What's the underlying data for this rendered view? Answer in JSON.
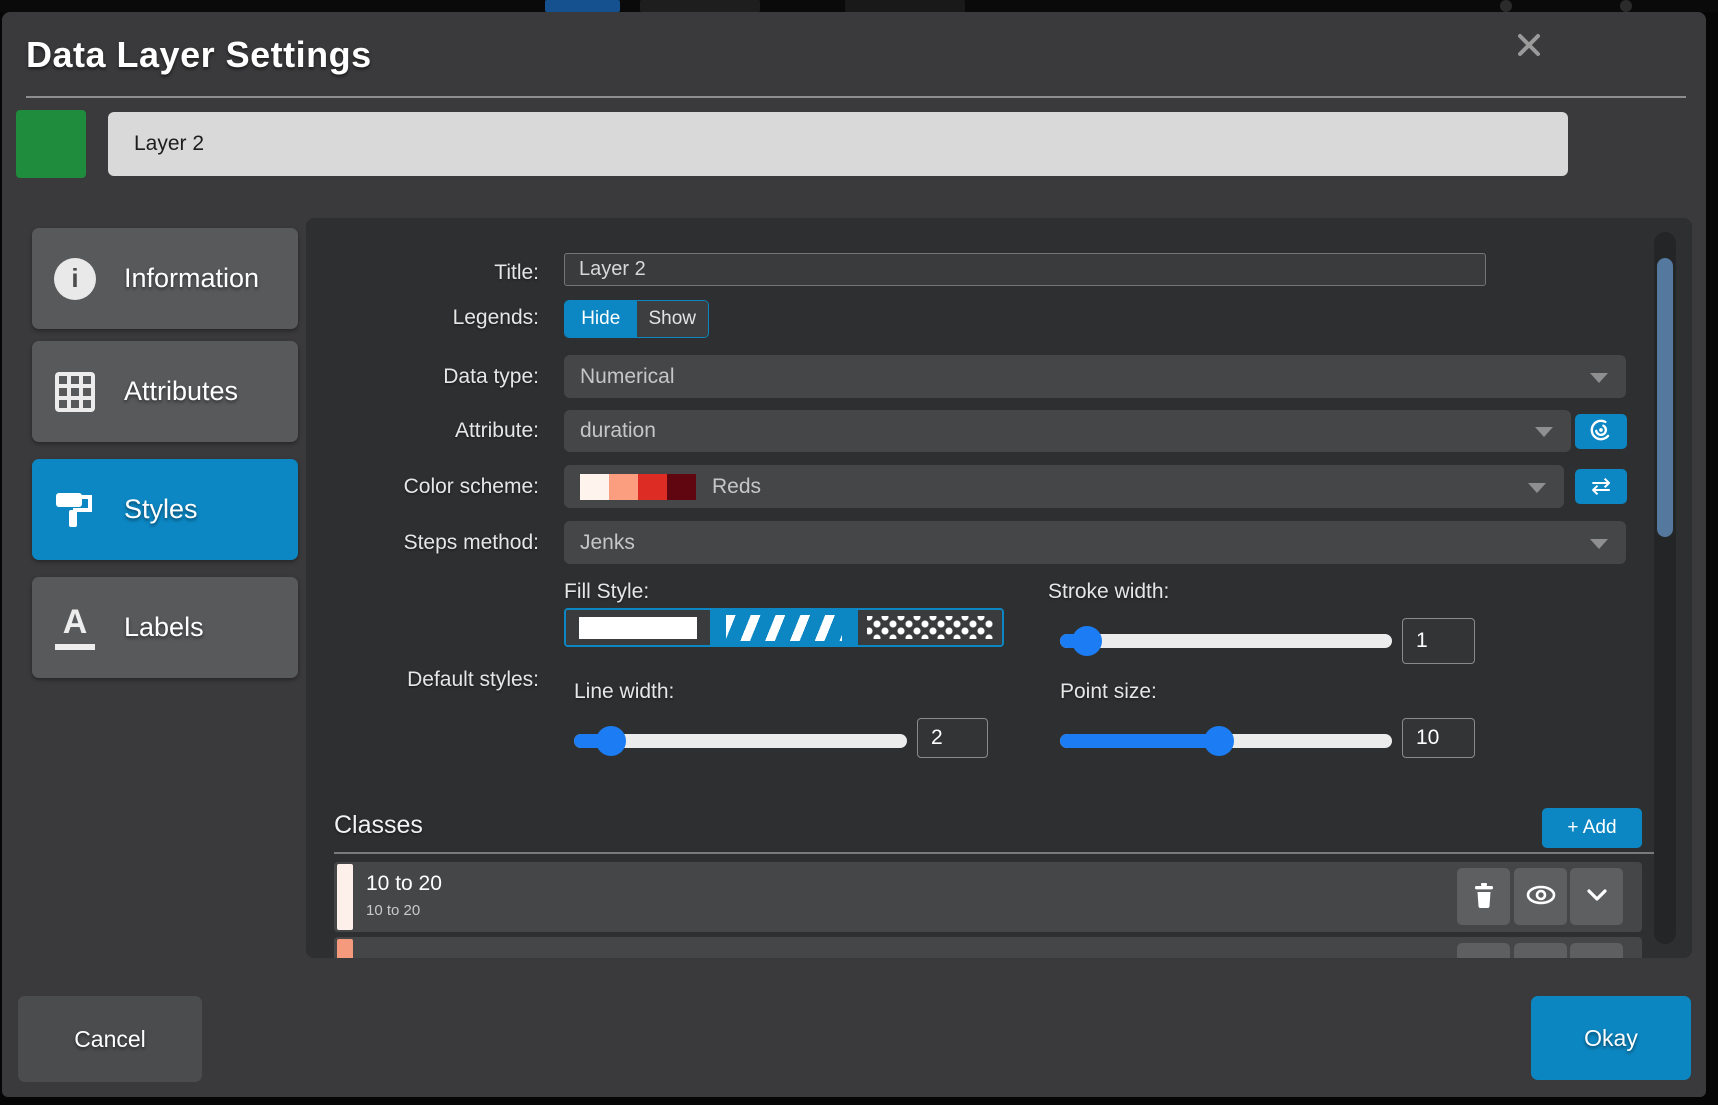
{
  "window": {
    "title": "Data Layer Settings"
  },
  "layer": {
    "name": "Layer 2",
    "swatch_color": "#1f8b3c"
  },
  "sidebar": {
    "items": [
      {
        "label": "Information",
        "icon": "info-icon",
        "active": false
      },
      {
        "label": "Attributes",
        "icon": "grid-icon",
        "active": false
      },
      {
        "label": "Styles",
        "icon": "paint-roller-icon",
        "active": true
      },
      {
        "label": "Labels",
        "icon": "label-a-icon",
        "active": false
      }
    ]
  },
  "form": {
    "title": {
      "label": "Title:",
      "value": "Layer 2"
    },
    "legends": {
      "label": "Legends:",
      "options": [
        "Hide",
        "Show"
      ],
      "selected": "Hide"
    },
    "data_type": {
      "label": "Data type:",
      "value": "Numerical"
    },
    "attribute": {
      "label": "Attribute:",
      "value": "duration"
    },
    "color_scheme": {
      "label": "Color scheme:",
      "value": "Reds",
      "palette": [
        "#fff3ee",
        "#fb9e80",
        "#dd2c24",
        "#5f0611"
      ]
    },
    "steps_method": {
      "label": "Steps method:",
      "value": "Jenks"
    },
    "default_styles_label": "Default styles:",
    "fill_style": {
      "label": "Fill Style:",
      "options": [
        "solid",
        "hatch",
        "dots"
      ],
      "selected": "hatch"
    },
    "stroke_width": {
      "label": "Stroke width:",
      "value": "1",
      "percent": 8
    },
    "line_width": {
      "label": "Line width:",
      "value": "2",
      "percent": 11
    },
    "point_size": {
      "label": "Point size:",
      "value": "10",
      "percent": 48
    }
  },
  "classes": {
    "heading": "Classes",
    "add_label": "+ Add",
    "items": [
      {
        "title": "10 to 20",
        "subtitle": "10 to 20",
        "swatch": "#fdf0ea"
      },
      {
        "title": "",
        "subtitle": "",
        "swatch": "#f59a7c"
      }
    ]
  },
  "footer": {
    "cancel_label": "Cancel",
    "okay_label": "Okay"
  },
  "colors": {
    "accent_blue": "#0c87c3",
    "slider_blue": "#1b7cf3",
    "scrollbar_thumb": "#54789e",
    "modal_bg": "#3a3a3c",
    "panel_bg": "#2e2f31"
  }
}
